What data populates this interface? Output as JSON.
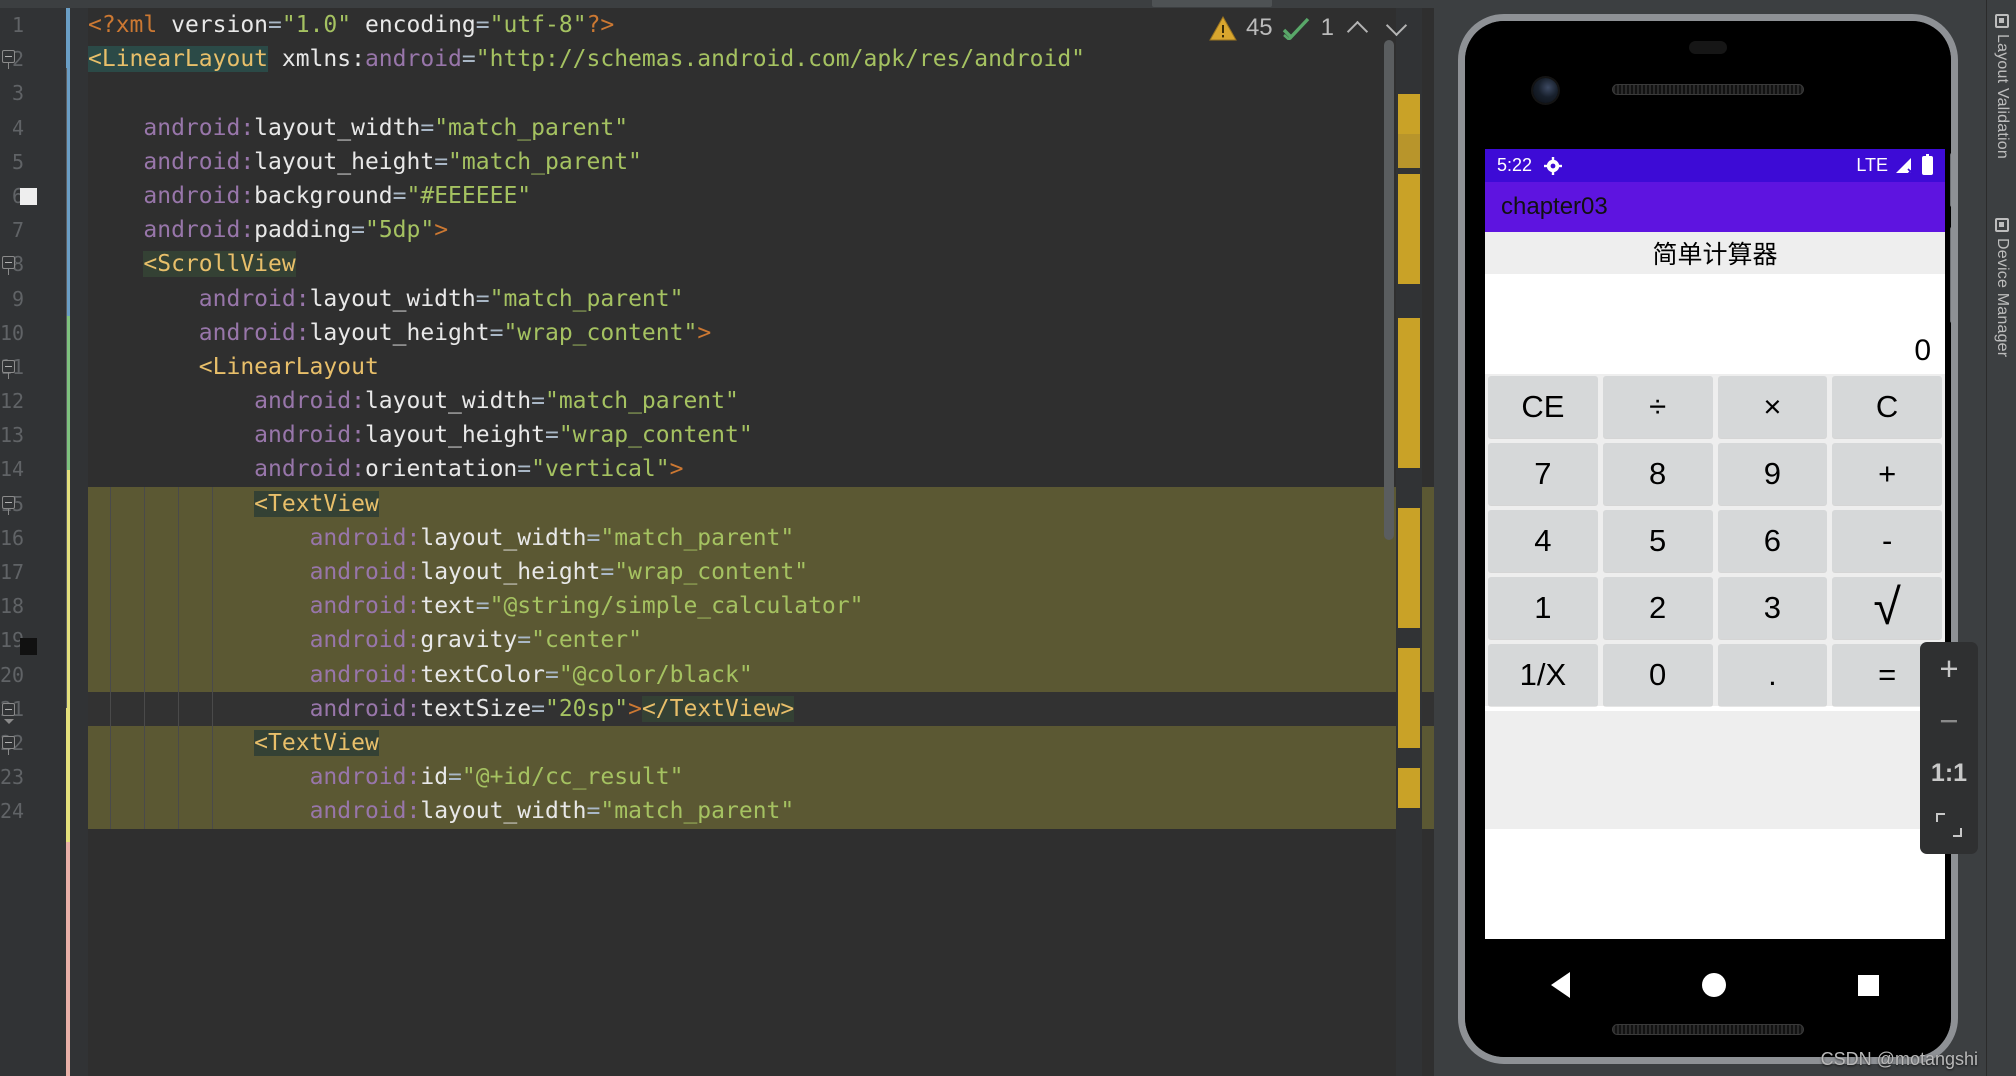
{
  "editor": {
    "language": "xml",
    "code_lines": [
      {
        "indent": 0,
        "tokens": [
          {
            "t": "<?xml ",
            "c": "punct"
          },
          {
            "t": "version",
            "c": "white"
          },
          {
            "t": "=",
            "c": "plain"
          },
          {
            "t": "\"1.0\"",
            "c": "str"
          },
          {
            "t": " encoding",
            "c": "white"
          },
          {
            "t": "=",
            "c": "plain"
          },
          {
            "t": "\"utf-8\"",
            "c": "str"
          },
          {
            "t": "?>",
            "c": "punct"
          }
        ]
      },
      {
        "indent": 0,
        "tokens": [
          {
            "t": "<LinearLayout",
            "c": "tag",
            "hl": "hl-tag2"
          },
          {
            "t": " xmlns:",
            "c": "white"
          },
          {
            "t": "android",
            "c": "ns"
          },
          {
            "t": "=",
            "c": "plain"
          },
          {
            "t": "\"http://schemas.android.com/apk/res/android\"",
            "c": "str"
          }
        ]
      },
      {
        "indent": 0,
        "tokens": []
      },
      {
        "indent": 2,
        "tokens": [
          {
            "t": "android:",
            "c": "ns"
          },
          {
            "t": "layout_width",
            "c": "white"
          },
          {
            "t": "=",
            "c": "plain"
          },
          {
            "t": "\"match_parent\"",
            "c": "str"
          }
        ]
      },
      {
        "indent": 2,
        "tokens": [
          {
            "t": "android:",
            "c": "ns"
          },
          {
            "t": "layout_height",
            "c": "white"
          },
          {
            "t": "=",
            "c": "plain"
          },
          {
            "t": "\"match_parent\"",
            "c": "str"
          }
        ]
      },
      {
        "indent": 2,
        "tokens": [
          {
            "t": "android:",
            "c": "ns"
          },
          {
            "t": "background",
            "c": "white"
          },
          {
            "t": "=",
            "c": "plain"
          },
          {
            "t": "\"#EEEEEE\"",
            "c": "str"
          }
        ]
      },
      {
        "indent": 2,
        "tokens": [
          {
            "t": "android:",
            "c": "ns"
          },
          {
            "t": "padding",
            "c": "white"
          },
          {
            "t": "=",
            "c": "plain"
          },
          {
            "t": "\"5dp\"",
            "c": "str"
          },
          {
            "t": ">",
            "c": "punct"
          }
        ]
      },
      {
        "indent": 2,
        "tokens": [
          {
            "t": "<ScrollView",
            "c": "tag",
            "hl": "hl-tag"
          }
        ]
      },
      {
        "indent": 4,
        "tokens": [
          {
            "t": "android:",
            "c": "ns"
          },
          {
            "t": "layout_width",
            "c": "white"
          },
          {
            "t": "=",
            "c": "plain"
          },
          {
            "t": "\"match_parent\"",
            "c": "str"
          }
        ]
      },
      {
        "indent": 4,
        "tokens": [
          {
            "t": "android:",
            "c": "ns"
          },
          {
            "t": "layout_height",
            "c": "white"
          },
          {
            "t": "=",
            "c": "plain"
          },
          {
            "t": "\"wrap_content\"",
            "c": "str"
          },
          {
            "t": ">",
            "c": "punct"
          }
        ]
      },
      {
        "indent": 4,
        "tokens": [
          {
            "t": "<LinearLayout",
            "c": "tag"
          }
        ]
      },
      {
        "indent": 6,
        "tokens": [
          {
            "t": "android:",
            "c": "ns"
          },
          {
            "t": "layout_width",
            "c": "white"
          },
          {
            "t": "=",
            "c": "plain"
          },
          {
            "t": "\"match_parent\"",
            "c": "str"
          }
        ]
      },
      {
        "indent": 6,
        "tokens": [
          {
            "t": "android:",
            "c": "ns"
          },
          {
            "t": "layout_height",
            "c": "white"
          },
          {
            "t": "=",
            "c": "plain"
          },
          {
            "t": "\"wrap_content\"",
            "c": "str"
          }
        ]
      },
      {
        "indent": 6,
        "tokens": [
          {
            "t": "android:",
            "c": "ns"
          },
          {
            "t": "orientation",
            "c": "white"
          },
          {
            "t": "=",
            "c": "plain"
          },
          {
            "t": "\"vertical\"",
            "c": "str"
          },
          {
            "t": ">",
            "c": "punct"
          }
        ]
      },
      {
        "indent": 6,
        "tokens": [
          {
            "t": "<TextView",
            "c": "tag",
            "hl": "hl-tag"
          }
        ]
      },
      {
        "indent": 8,
        "tokens": [
          {
            "t": "android:",
            "c": "ns"
          },
          {
            "t": "layout_width",
            "c": "white"
          },
          {
            "t": "=",
            "c": "plain"
          },
          {
            "t": "\"match_parent\"",
            "c": "str"
          }
        ]
      },
      {
        "indent": 8,
        "tokens": [
          {
            "t": "android:",
            "c": "ns"
          },
          {
            "t": "layout_height",
            "c": "white"
          },
          {
            "t": "=",
            "c": "plain"
          },
          {
            "t": "\"wrap_content\"",
            "c": "str"
          }
        ]
      },
      {
        "indent": 8,
        "tokens": [
          {
            "t": "android:",
            "c": "ns"
          },
          {
            "t": "text",
            "c": "white"
          },
          {
            "t": "=",
            "c": "plain"
          },
          {
            "t": "\"@string/simple_calculator\"",
            "c": "str"
          }
        ]
      },
      {
        "indent": 8,
        "tokens": [
          {
            "t": "android:",
            "c": "ns"
          },
          {
            "t": "gravity",
            "c": "white"
          },
          {
            "t": "=",
            "c": "plain"
          },
          {
            "t": "\"center\"",
            "c": "str"
          }
        ]
      },
      {
        "indent": 8,
        "tokens": [
          {
            "t": "android:",
            "c": "ns"
          },
          {
            "t": "textColor",
            "c": "white"
          },
          {
            "t": "=",
            "c": "plain"
          },
          {
            "t": "\"@color/black\"",
            "c": "str"
          }
        ]
      },
      {
        "indent": 8,
        "tokens": [
          {
            "t": "android:",
            "c": "ns"
          },
          {
            "t": "textSize",
            "c": "white"
          },
          {
            "t": "=",
            "c": "plain"
          },
          {
            "t": "\"20sp\"",
            "c": "str"
          },
          {
            "t": ">",
            "c": "punct"
          },
          {
            "t": "</TextView>",
            "c": "tag",
            "hl": "hl-tag"
          }
        ]
      },
      {
        "indent": 6,
        "tokens": [
          {
            "t": "<TextView",
            "c": "tag",
            "hl": "hl-tag"
          }
        ]
      },
      {
        "indent": 8,
        "tokens": [
          {
            "t": "android:",
            "c": "ns"
          },
          {
            "t": "id",
            "c": "white"
          },
          {
            "t": "=",
            "c": "plain"
          },
          {
            "t": "\"@+id/cc_result\"",
            "c": "str"
          }
        ]
      },
      {
        "indent": 8,
        "tokens": [
          {
            "t": "android:",
            "c": "ns"
          },
          {
            "t": "layout_width",
            "c": "white"
          },
          {
            "t": "=",
            "c": "plain"
          },
          {
            "t": "\"match_parent\"",
            "c": "str"
          }
        ]
      }
    ],
    "line_numbers": [
      "1",
      "2",
      "3",
      "4",
      "5",
      "6",
      "7",
      "8",
      "9",
      "10",
      "11",
      "12",
      "13",
      "14",
      "15",
      "16",
      "17",
      "18",
      "19",
      "20",
      "21",
      "22",
      "23",
      "24"
    ],
    "inspection": {
      "warning_icon": "warning-triangle-icon",
      "warning_count": "45",
      "ok_icon": "double-check-icon",
      "ok_count": "1",
      "prev_icon": "chevron-up-icon",
      "next_icon": "chevron-down-icon"
    }
  },
  "emulator": {
    "status_bar": {
      "time": "5:22",
      "settings_icon": "gear-icon",
      "network_label": "LTE",
      "signal_icon": "signal-bars-icon",
      "battery_icon": "battery-full-icon"
    },
    "app_bar": {
      "title": "chapter03"
    },
    "calculator": {
      "title": "简单计算器",
      "result": "0",
      "keys": [
        [
          "CE",
          "÷",
          "×",
          "C"
        ],
        [
          "7",
          "8",
          "9",
          "+"
        ],
        [
          "4",
          "5",
          "6",
          "-"
        ],
        [
          "1",
          "2",
          "3",
          "√"
        ],
        [
          "1/X",
          "0",
          ".",
          "="
        ]
      ]
    },
    "nav_bar": {
      "back_icon": "nav-back-triangle-icon",
      "home_icon": "nav-home-circle-icon",
      "recents_icon": "nav-recents-square-icon"
    },
    "tools": {
      "zoom_in": "+",
      "zoom_out": "−",
      "actual_size": "1:1",
      "fit_icon": "fit-to-screen-icon"
    }
  },
  "tool_strip": {
    "items": [
      {
        "label": "Layout Validation",
        "icon": "layout-validation-icon"
      },
      {
        "label": "Device Manager",
        "icon": "device-manager-icon"
      }
    ]
  },
  "watermark": {
    "text": "CSDN @motangshi"
  },
  "colors": {
    "editor_bg": "#2f2f2f",
    "gutter_bg": "#313335",
    "selection": "#5b5833",
    "ide_chrome": "#3c3f41",
    "accent_purple": "#5e14e0",
    "status_purple": "#3d0bd6",
    "warning_yellow": "#d9a62e",
    "ok_green": "#59a869",
    "key_bg": "#d6d8d9"
  }
}
